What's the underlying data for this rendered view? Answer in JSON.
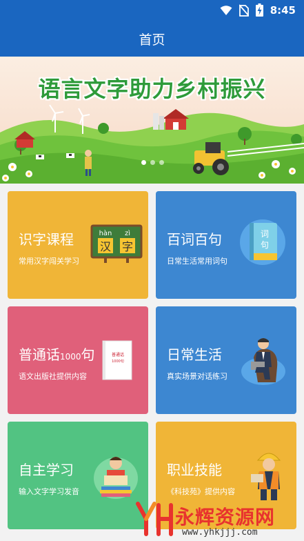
{
  "status_bar": {
    "time": "8:45",
    "icons": [
      "wifi-icon",
      "no-sim-icon",
      "battery-charging-icon"
    ]
  },
  "app_bar": {
    "title": "首页"
  },
  "banner": {
    "title": "语言文字助力乡村振兴",
    "page_count": 3,
    "active_page": 1
  },
  "cards": [
    {
      "title": "识字课程",
      "subtitle": "常用汉字闯关学习",
      "art": "chalkboard-hanzi-icon",
      "art_text": [
        "hàn",
        "zì",
        "汉",
        "字"
      ],
      "color": "#f0b537"
    },
    {
      "title": "百词百句",
      "subtitle": "日常生活常用词句",
      "art": "book-ciju-icon",
      "art_text": [
        "词",
        "句"
      ],
      "color": "#3d87d1"
    },
    {
      "title": "普通话",
      "title_suffix": "1000",
      "title_end": "句",
      "subtitle": "语文出版社提供内容",
      "art": "booklet-icon",
      "art_text": [
        "普通话",
        "1000句"
      ],
      "color": "#e0607a"
    },
    {
      "title": "日常生活",
      "subtitle": "真实场景对话练习",
      "art": "businessman-armchair-icon",
      "color": "#3d87d1"
    },
    {
      "title": "自主学习",
      "subtitle": "输入文字学习发音",
      "art": "student-reading-icon",
      "color": "#52c382"
    },
    {
      "title": "职业技能",
      "subtitle": "《科技苑》提供内容",
      "art": "construction-worker-icon",
      "color": "#f0b537"
    }
  ],
  "watermark": {
    "logo": "YH",
    "name": "永辉资源网",
    "url": "www.yhkjjj.com"
  }
}
